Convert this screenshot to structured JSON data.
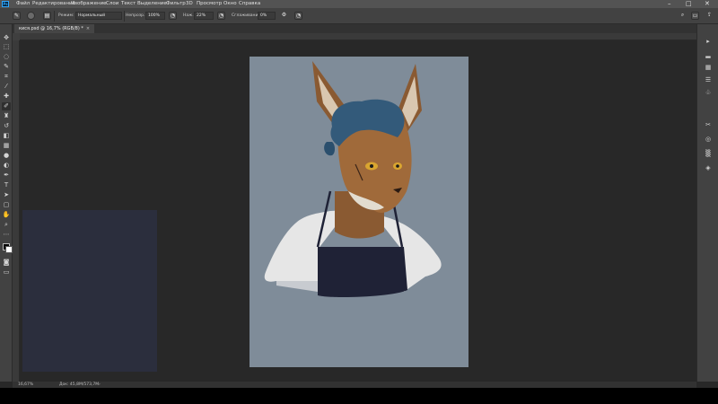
{
  "menu": {
    "items": [
      "Файл",
      "Редактирование",
      "Изображение",
      "Слои",
      "Текст",
      "Выделение",
      "Фильтр",
      "3D",
      "Просмотр",
      "Окно",
      "Справка"
    ]
  },
  "app": {
    "logo": "Ps"
  },
  "options": {
    "mode_label": "Режим:",
    "mode_value": "Нормальный",
    "opacity_label": "Непрозр.:",
    "opacity_value": "100%",
    "pressure_label": "Наж.:",
    "pressure_value": "22%",
    "smoothing_label": "Сглаживание:",
    "smoothing_value": "0%"
  },
  "document": {
    "tab_title": "кися.psd @ 16,7% (RGB/8) *",
    "tab_close": "×"
  },
  "status": {
    "zoom": "16,67%",
    "doc_size": "Док: 45,8M/573,7M",
    "arrow": "›"
  },
  "window_controls": {
    "minimize": "–",
    "maximize": "□",
    "close": "✕"
  },
  "colors": {
    "canvas_bg": "#7f8c99",
    "workspace": "#282828",
    "panel": "#424242",
    "left_panel": "#2b2e3d"
  },
  "icons": {
    "tools": [
      "move-icon",
      "marquee-icon",
      "lasso-icon",
      "quick-select-icon",
      "crop-icon",
      "eyedropper-icon",
      "healing-icon",
      "brush-icon",
      "stamp-icon",
      "history-brush-icon",
      "eraser-icon",
      "gradient-icon",
      "blur-icon",
      "dodge-icon",
      "pen-icon",
      "type-icon",
      "path-select-icon",
      "shape-icon",
      "hand-icon",
      "zoom-icon",
      "more-icon"
    ],
    "right": [
      "history-icon",
      "levels-icon",
      "swatches-icon",
      "properties-icon",
      "brushes-icon",
      "adjustments-icon",
      "layers-icon",
      "channels-icon",
      "paths-icon"
    ]
  }
}
